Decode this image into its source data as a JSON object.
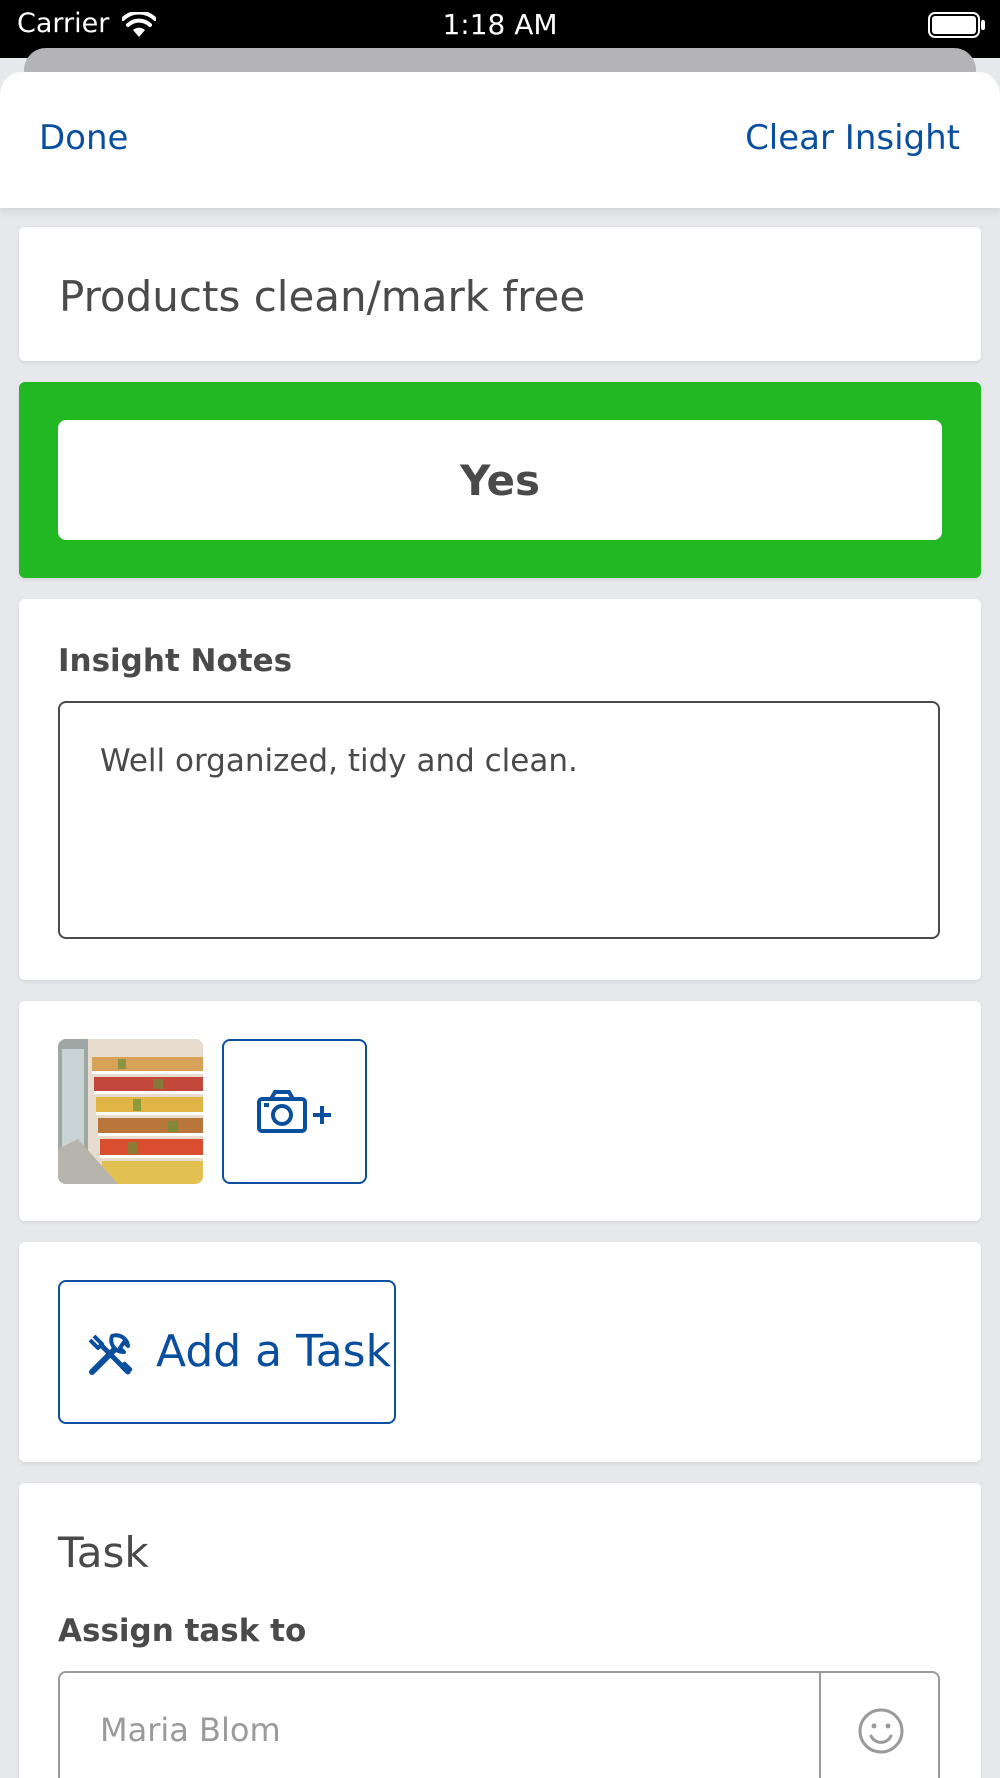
{
  "status_bar": {
    "carrier": "Carrier",
    "time": "1:18 AM",
    "wifi_icon": "wifi-icon",
    "battery_icon": "battery-icon"
  },
  "nav": {
    "done_label": "Done",
    "clear_label": "Clear Insight"
  },
  "insight": {
    "title": "Products clean/mark free",
    "answer": "Yes",
    "answer_color": "#22b823"
  },
  "notes": {
    "label": "Insight Notes",
    "value": "Well organized, tidy and clean."
  },
  "photos": {
    "thumbnail_icon": "store-shelf-photo",
    "add_photo_icon": "camera-plus-icon"
  },
  "task_button": {
    "label": "Add a Task",
    "icon": "tools-icon"
  },
  "task": {
    "title": "Task",
    "assign_label": "Assign task to",
    "assignee": "Maria Blom",
    "picker_icon": "smiley-icon"
  },
  "colors": {
    "accent": "#0a4f9e",
    "text": "#4a4a4a",
    "background": "#e6e8eb"
  }
}
